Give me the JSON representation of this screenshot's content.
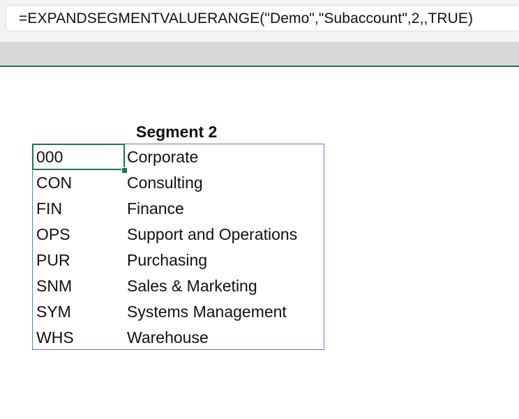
{
  "formula_bar": {
    "formula": "=EXPANDSEGMENTVALUERANGE(\"Demo\",\"Subaccount\",2,,TRUE)"
  },
  "sheet": {
    "header": "Segment 2",
    "rows": [
      {
        "code": "000",
        "name": "Corporate"
      },
      {
        "code": "CON",
        "name": "Consulting"
      },
      {
        "code": "FIN",
        "name": "Finance"
      },
      {
        "code": "OPS",
        "name": "Support and Operations"
      },
      {
        "code": "PUR",
        "name": "Purchasing"
      },
      {
        "code": "SNM",
        "name": "Sales & Marketing"
      },
      {
        "code": "SYM",
        "name": "Systems Management"
      },
      {
        "code": "WHS",
        "name": "Warehouse"
      }
    ]
  },
  "colors": {
    "accent": "#217346",
    "table_border": "#5b7fd1"
  }
}
